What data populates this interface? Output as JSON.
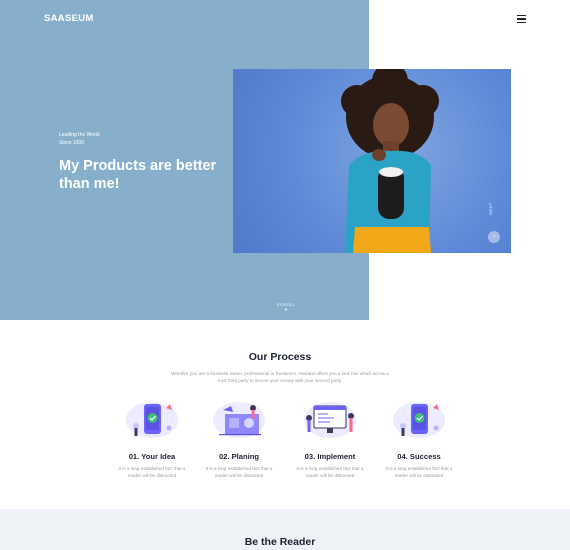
{
  "brand": {
    "logo": "SAASEUM"
  },
  "header": {
    "menu_icon": "hamburger-icon"
  },
  "hero": {
    "tag_line_1": "Leading the World",
    "tag_line_2": "Since 1000",
    "title": "My Products are better than me!",
    "vertical_label": "NEXT",
    "next_icon": "chevron-right-icon",
    "scroll_label": "SCROLL",
    "scroll_icon": "chevron-down-icon"
  },
  "process": {
    "title": "Our Process",
    "description": "Whether you are a business owner, professional or freelancer, Nowami offers you a lock box which act as a trust third party to secure your money with your second party.",
    "steps": [
      {
        "title": "01. Your Idea",
        "description": "It is a long established fact that a reader will be distracted",
        "icon": "phone-check-icon"
      },
      {
        "title": "02. Planing",
        "description": "It is a long established fact that a reader will be distracted",
        "icon": "planning-board-icon"
      },
      {
        "title": "03. Implement",
        "description": "It is a long established fact that a reader will be distracted",
        "icon": "monitor-team-icon"
      },
      {
        "title": "04. Success",
        "description": "It is a long established fact that a reader will be distracted",
        "icon": "phone-check-icon"
      }
    ]
  },
  "reader": {
    "title": "Be the Reader"
  },
  "colors": {
    "hero_bg": "#87afcc",
    "accent": "#6c63ff",
    "section_bg": "#eef1f6",
    "success": "#3bbf7a"
  }
}
